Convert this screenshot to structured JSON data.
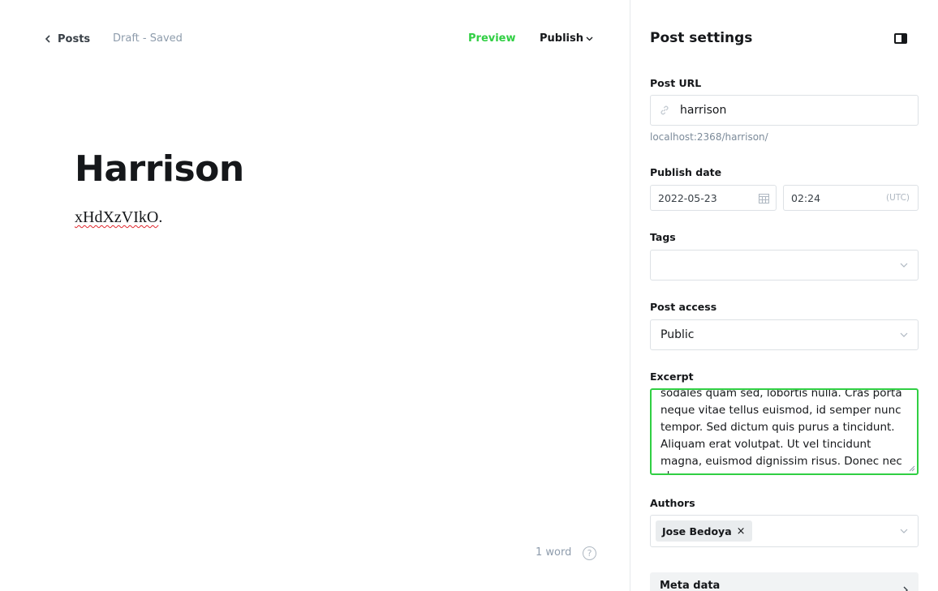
{
  "header": {
    "back_label": "Posts",
    "status": "Draft - Saved",
    "preview_label": "Preview",
    "publish_label": "Publish"
  },
  "post": {
    "title": "Harrison",
    "body": "xHdXzVIkO",
    "body_punct": "."
  },
  "footer": {
    "word_count": "1 word",
    "help_glyph": "?"
  },
  "settings": {
    "title": "Post settings",
    "url_label": "Post URL",
    "url_value": "harrison",
    "url_hint": "localhost:2368/harrison/",
    "publish_date_label": "Publish date",
    "date_value": "2022-05-23",
    "time_value": "02:24",
    "timezone": "(UTC)",
    "tags_label": "Tags",
    "access_label": "Post access",
    "access_value": "Public",
    "excerpt_label": "Excerpt",
    "excerpt_lines": [
      "sodales quam sed, lobortis nulla. Cras porta",
      "neque vitae tellus euismod, id semper nunc",
      "tempor. Sed dictum quis purus a tincidunt.",
      "Aliquam erat volutpat. Ut vel tincidunt",
      "magna, euismod dignissim risus. Donec nec u"
    ],
    "authors_label": "Authors",
    "author_name": "Jose Bedoya",
    "author_remove": "×",
    "meta_label": "Meta data"
  },
  "colors": {
    "accent_green": "#30cf43",
    "muted_text": "#8e9cac",
    "border": "#dde1e5"
  },
  "icons": [
    "chevron-left-icon",
    "chevron-down-icon",
    "link-icon",
    "calendar-icon",
    "sidebar-toggle-icon",
    "help-icon",
    "chevron-right-icon"
  ]
}
